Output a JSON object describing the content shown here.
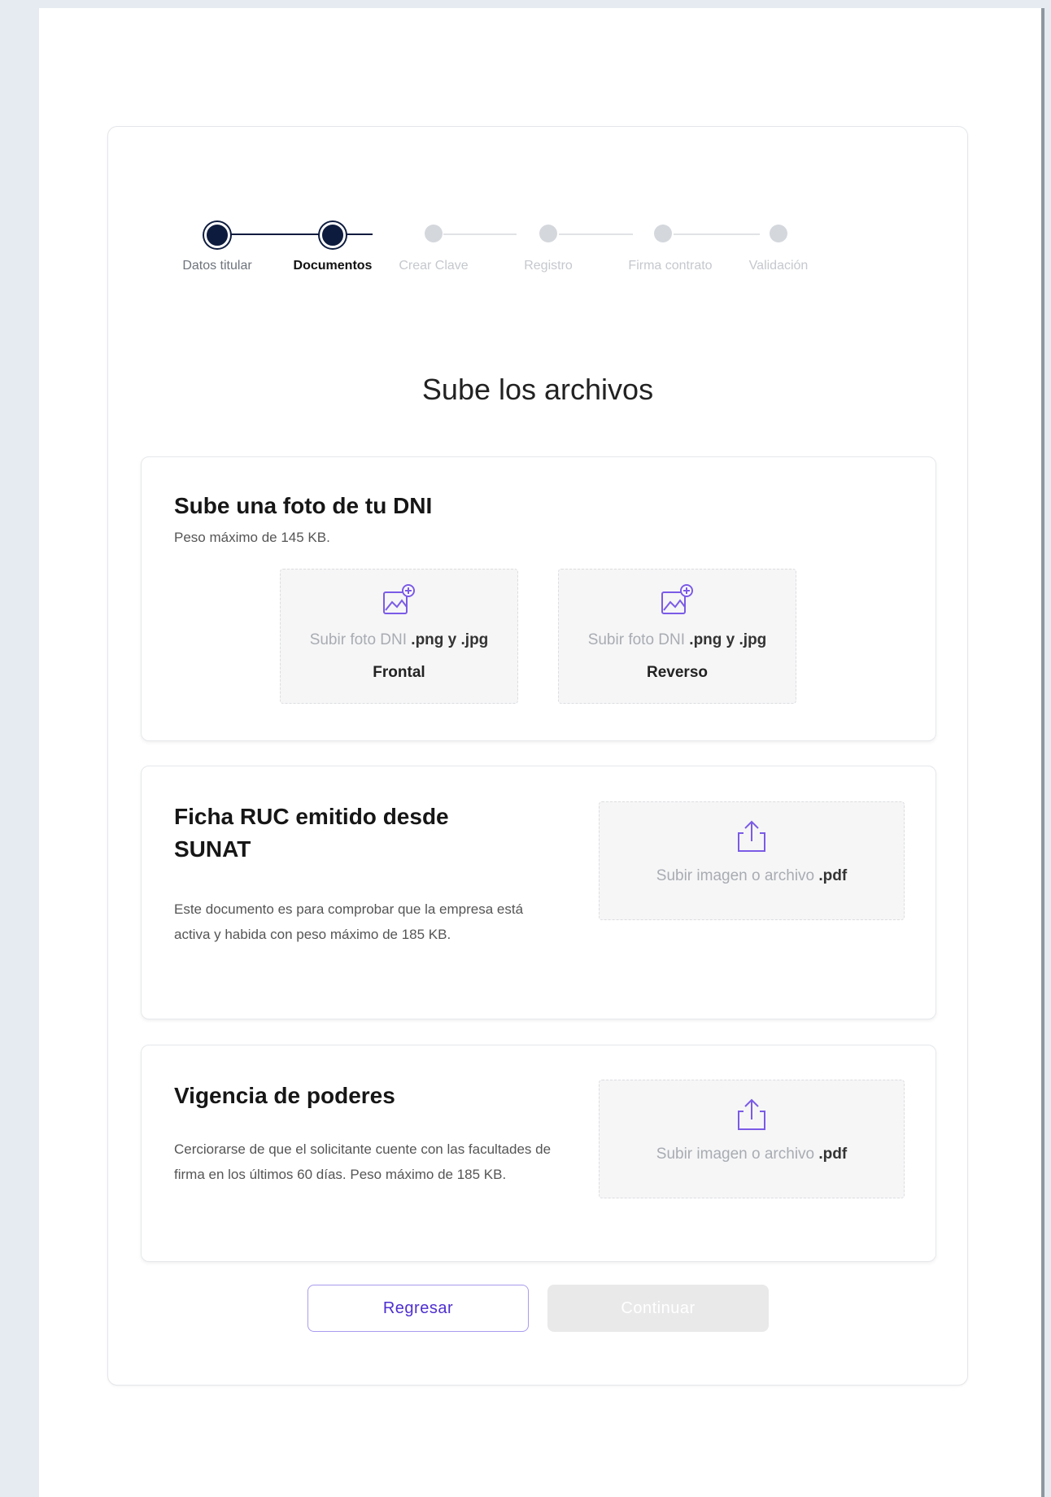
{
  "stepper": {
    "steps": [
      {
        "label": "Datos titular",
        "state": "done"
      },
      {
        "label": "Documentos",
        "state": "current"
      },
      {
        "label": "Crear Clave",
        "state": "pending"
      },
      {
        "label": "Registro",
        "state": "pending"
      },
      {
        "label": "Firma contrato",
        "state": "pending"
      },
      {
        "label": "Validación",
        "state": "pending"
      }
    ]
  },
  "main": {
    "title": "Sube los archivos"
  },
  "dni_section": {
    "title": "Sube una foto de tu DNI",
    "subtitle": "Peso máximo de 145 KB.",
    "front": {
      "icon": "image-upload-icon",
      "text": "Subir foto DNI ",
      "ext": ".png y .jpg",
      "caption": "Frontal"
    },
    "back": {
      "icon": "image-upload-icon",
      "text": "Subir foto DNI ",
      "ext": ".png y .jpg",
      "caption": "Reverso"
    }
  },
  "ruc_section": {
    "title": "Ficha RUC emitido desde SUNAT",
    "description": "Este documento es para comprobar que la empresa está activa y habida con peso máximo de 185 KB.",
    "upload": {
      "icon": "upload-icon",
      "text": "Subir imagen o archivo ",
      "ext": ".pdf"
    }
  },
  "poderes_section": {
    "title": "Vigencia de poderes",
    "description": "Cerciorarse de que el solicitante cuente con las facultades de firma en los últimos 60 días. Peso máximo de 185 KB.",
    "upload": {
      "icon": "upload-icon",
      "text": "Subir imagen o archivo ",
      "ext": ".pdf"
    }
  },
  "actions": {
    "back_label": "Regresar",
    "next_label": "Continuar"
  },
  "colors": {
    "step_active": "#0d1b3e",
    "button_outline": "#a99bee",
    "button_text": "#4e2fd0",
    "button_disabled": "#e9e9ea"
  }
}
